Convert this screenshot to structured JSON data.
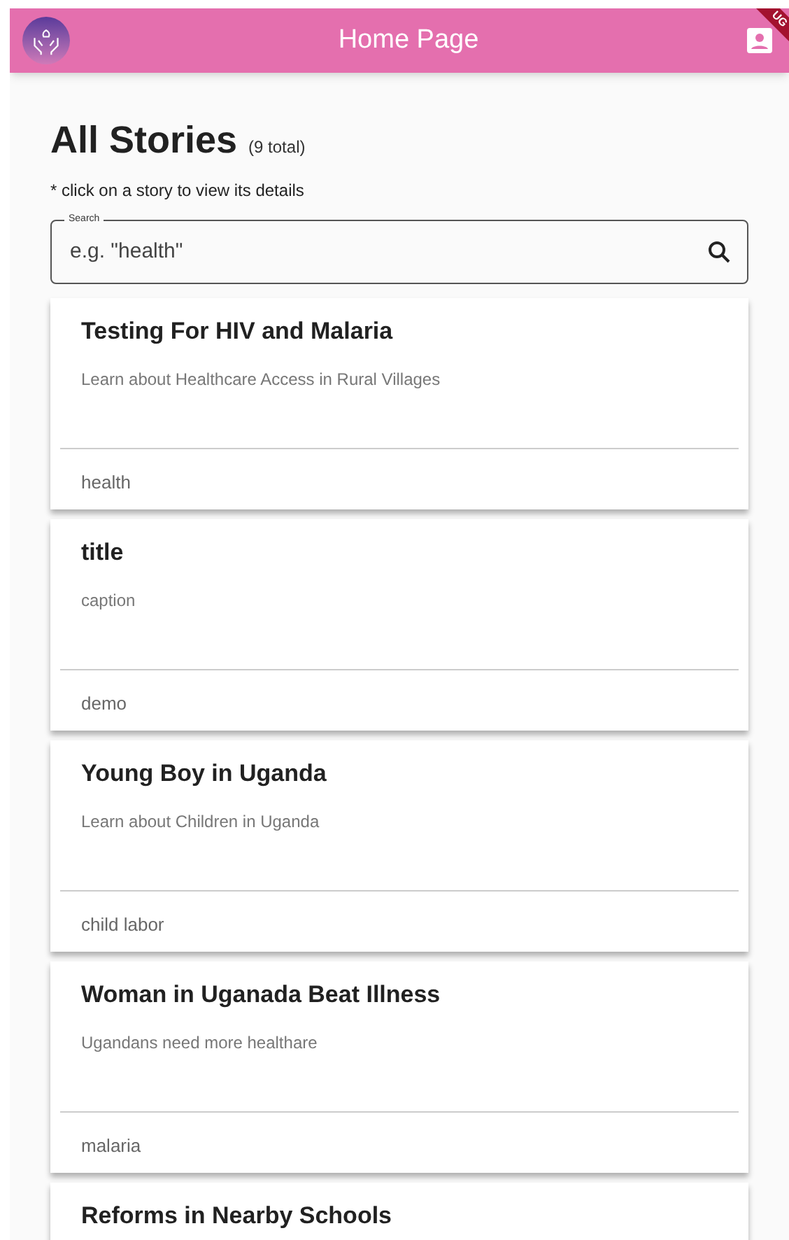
{
  "app_bar": {
    "title": "Home Page",
    "debug_banner": "UG"
  },
  "header": {
    "title": "All Stories",
    "count": "(9 total)",
    "hint": "* click on a story to view its details"
  },
  "search": {
    "label": "Search",
    "placeholder": "e.g. \"health\""
  },
  "stories": [
    {
      "title": "Testing For HIV and Malaria",
      "caption": "Learn about Healthcare Access in Rural Villages",
      "tag": "health"
    },
    {
      "title": "title",
      "caption": "caption",
      "tag": "demo"
    },
    {
      "title": "Young Boy in Uganda",
      "caption": "Learn about Children in Uganda",
      "tag": "child labor"
    },
    {
      "title": "Woman in Uganada Beat Illness",
      "caption": "Ugandans need more healthare",
      "tag": "malaria"
    },
    {
      "title": "Reforms in Nearby Schools"
    }
  ]
}
